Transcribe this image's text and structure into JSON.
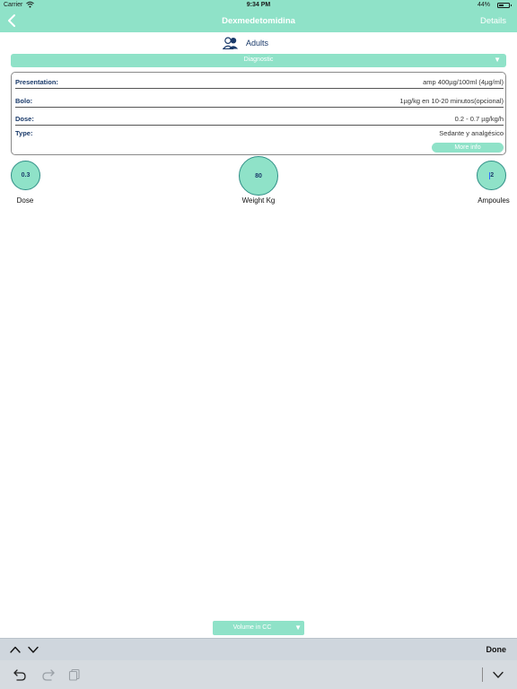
{
  "status_bar": {
    "carrier": "Carrier",
    "time": "9:34 PM",
    "battery": "44%",
    "battery_level": 0.44
  },
  "nav": {
    "title": "Dexmedetomidina",
    "details": "Details"
  },
  "population": {
    "label": "Adults"
  },
  "diagnostic": {
    "placeholder": "Diagnostic"
  },
  "info": {
    "presentation_label": "Presentation:",
    "presentation_value": "amp 400µg/100ml (4µg/ml)",
    "bolo_label": "Bolo:",
    "bolo_value": "1µg/kg en 10-20 minutos(opcional)",
    "dose_label": "Dose:",
    "dose_value": "0.2 - 0.7 µg/kg/h",
    "type_label": "Type:",
    "type_value": "Sedante y analgésico",
    "more_info": "More info"
  },
  "inputs": {
    "dose_value": "0.3",
    "dose_label": "Dose",
    "weight_value": "80",
    "weight_label": "Weight Kg",
    "ampoules_value": "2",
    "ampoules_label": "Ampoules"
  },
  "volume": {
    "label": "Volume in CC"
  },
  "keyboard": {
    "done": "Done"
  },
  "icons": {
    "back": "chevron-left-icon",
    "users": "users-icon",
    "up": "chevron-up-icon",
    "down": "chevron-down-icon",
    "undo": "undo-icon",
    "redo": "redo-icon",
    "paste": "paste-icon",
    "hide": "keyboard-hide-icon"
  },
  "colors": {
    "accent": "#8fe2c8",
    "circle_border": "#2f8f86",
    "label_text": "#1a3a6a"
  }
}
